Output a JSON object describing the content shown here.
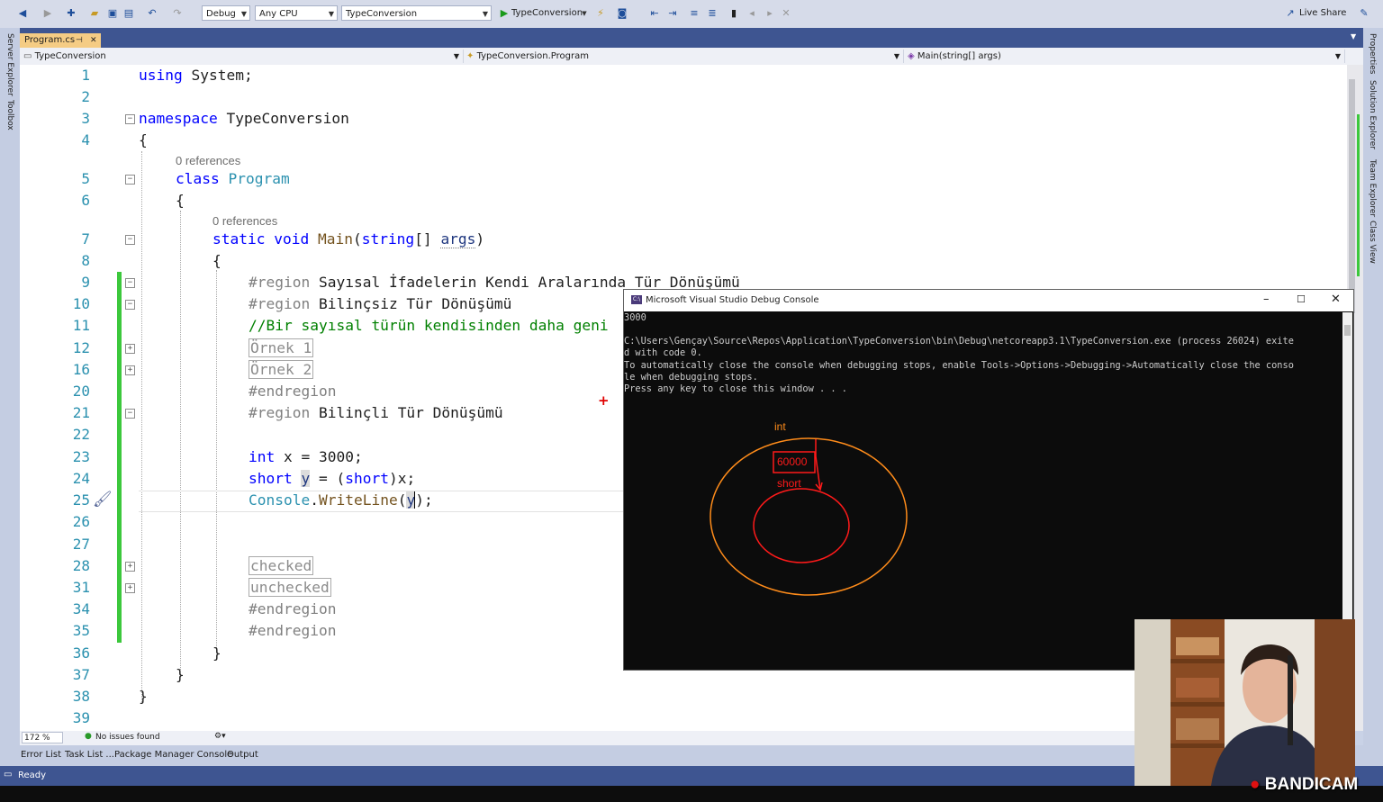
{
  "toolbar": {
    "config": "Debug",
    "platform": "Any CPU",
    "startup_project": "TypeConversion",
    "run_label": "TypeConversion",
    "live_share": "Live Share"
  },
  "left_strip": {
    "server_explorer": "Server Explorer",
    "toolbox": "Toolbox"
  },
  "right_strip": {
    "properties": "Properties",
    "solution_explorer": "Solution Explorer",
    "team_explorer": "Team Explorer",
    "class_view": "Class View"
  },
  "tabs": {
    "active": "Program.cs",
    "pin": "⊣",
    "close": "✕"
  },
  "navbar": {
    "project": "TypeConversion",
    "type": "TypeConversion.Program",
    "member": "Main(string[] args)"
  },
  "editor": {
    "line_numbers": [
      "1",
      "2",
      "3",
      "4",
      "5",
      "6",
      "7",
      "8",
      "9",
      "10",
      "11",
      "12",
      "16",
      "20",
      "21",
      "22",
      "23",
      "24",
      "25",
      "26",
      "27",
      "28",
      "31",
      "34",
      "35",
      "36",
      "37",
      "38",
      "39"
    ],
    "refs0": "0 references",
    "refs1": "0 references",
    "using_kw": "using",
    "using_rest": " System;",
    "namespace_kw": "namespace",
    "namespace_rest": " TypeConversion",
    "brace_open": "{",
    "brace_close": "}",
    "class_kw": "class",
    "class_name": "Program",
    "static_kw": "static",
    "void_kw": "void",
    "main_name": "Main",
    "paren_open": "(",
    "string_kw": "string",
    "arr": "[] ",
    "args": "args",
    "paren_close": ")",
    "region_kw": "#region",
    "region1": " Sayısal İfadelerin Kendi Aralarında Tür Dönüşümü",
    "region2": " Bilinçsiz Tür Dönüşümü",
    "comment": "//Bir sayısal türün kendisinden daha geni",
    "ornek1": "Örnek 1",
    "ornek2": "Örnek 2",
    "endregion": "#endregion",
    "region3": " Bilinçli Tür Dönüşümü",
    "int_kw": "int",
    "line23_rest": " x = 3000;",
    "short_kw": "short",
    "y_var": "y",
    "line24_mid": " = (",
    "line24_end": ")x;",
    "console_class": "Console",
    "dot": ".",
    "writeline": "WriteLine",
    "line25_end": ");",
    "checked": "checked",
    "unchecked": "unchecked",
    "plus_mark": "+"
  },
  "status_line": {
    "zoom": "172 %",
    "issues": "No issues found"
  },
  "bottom_tabs": [
    "Error List",
    "Task List ...",
    "Package Manager Console",
    "Output"
  ],
  "statusbar": {
    "ready": "Ready"
  },
  "console": {
    "title": "Microsoft Visual Studio Debug Console",
    "lines": [
      "3000",
      "",
      "C:\\Users\\Gençay\\Source\\Repos\\Application\\TypeConversion\\bin\\Debug\\netcoreapp3.1\\TypeConversion.exe (process 26024) exite",
      "d with code 0.",
      "To automatically close the console when debugging stops, enable Tools->Options->Debugging->Automatically close the conso",
      "le when debugging stops.",
      "Press any key to close this window . . ."
    ],
    "drawing": {
      "outer_label": "int",
      "value_label": "60000",
      "inner_label": "short",
      "outer_color": "#ff8c1a",
      "inner_color": "#ff1a1a"
    }
  },
  "watermark": "BANDICAM"
}
